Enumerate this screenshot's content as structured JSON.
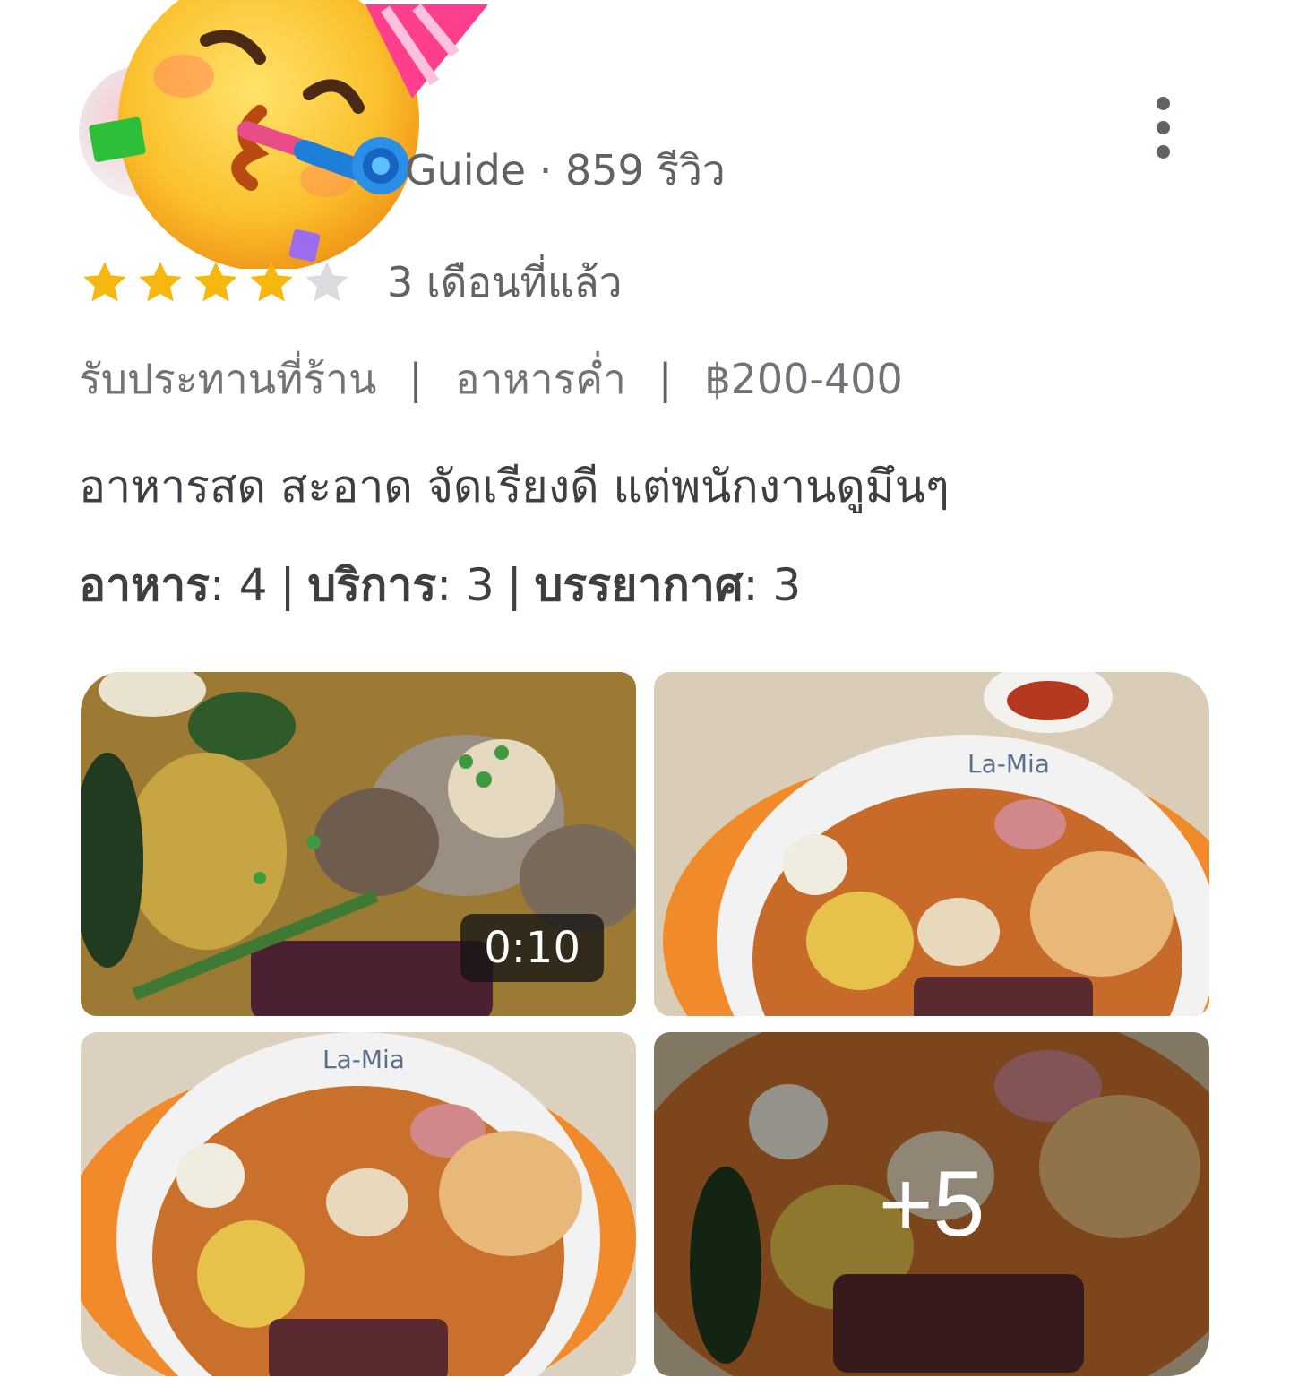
{
  "review": {
    "author_meta": "Guide · 859 รีวิว",
    "rating": 4,
    "rating_max": 5,
    "time_ago": "3 เดือนที่แล้ว",
    "chips": [
      "รับประทานที่ร้าน",
      "อาหารค่ำ",
      "฿200-400"
    ],
    "chip_separator": "|",
    "text": "อาหารสด สะอาด จัดเรียงดี แต่พนักงานดูมึนๆ",
    "subratings": [
      {
        "label": "อาหาร",
        "value": "4"
      },
      {
        "label": "บริการ",
        "value": "3"
      },
      {
        "label": "บรรยากาศ",
        "value": "3"
      }
    ]
  },
  "photos": {
    "video_duration": "0:10",
    "more_count": "+5",
    "bowl_brand": "La-Mia"
  },
  "colors": {
    "star_filled": "#f6b70f",
    "star_empty": "#dadce0",
    "text_secondary": "#5f6368",
    "text_primary": "#3c4043"
  },
  "icons": [
    "party-face-emoji-icon",
    "more-vert-icon",
    "star-icon"
  ]
}
